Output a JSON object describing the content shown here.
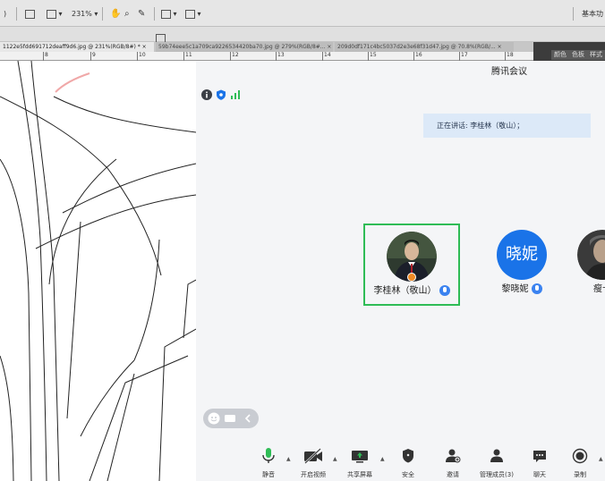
{
  "photoshop": {
    "zoom_label": "231%",
    "workspace_label": "基本功",
    "tabs": [
      {
        "label": "1122e5fdd691712deaff9d6.jpg @ 231%(RGB/8#) * ×",
        "active": true
      },
      {
        "label": "59b74eee5c1a709ca9226534420ba70.jpg @ 279%(RGB/8#... ×",
        "active": false
      },
      {
        "label": "209d0df171c4bc5037d2e3e68f31d47.jpg @ 70.8%(RGB/... ×",
        "active": false
      }
    ],
    "ruler_ticks": [
      "8",
      "9",
      "10",
      "11",
      "12",
      "13",
      "14",
      "15",
      "16",
      "17",
      "18"
    ],
    "panel_tabs": [
      "颜色",
      "色板",
      "样式"
    ]
  },
  "meeting": {
    "title": "腾讯会议",
    "speaking_text": "正在讲话: 李桂林（敬山）；",
    "participants": [
      {
        "name": "李桂林（敬山）",
        "avatar_text": "",
        "host": true,
        "active": true
      },
      {
        "name": "黎晓妮",
        "avatar_text": "晓妮",
        "host": false,
        "active": false
      },
      {
        "name": "瘦十",
        "avatar_text": "",
        "host": false,
        "active": false
      }
    ],
    "toolbar": {
      "mute": "静音",
      "video": "开启视频",
      "share": "共享屏幕",
      "security": "安全",
      "invite": "邀请",
      "manage": "管理成员(3)",
      "chat": "聊天",
      "record": "录制"
    },
    "colors": {
      "accent": "#1a73e8",
      "active_border": "#2fbc56",
      "mic": "#3a82f0",
      "speaking_bg": "#dce9f8"
    }
  }
}
